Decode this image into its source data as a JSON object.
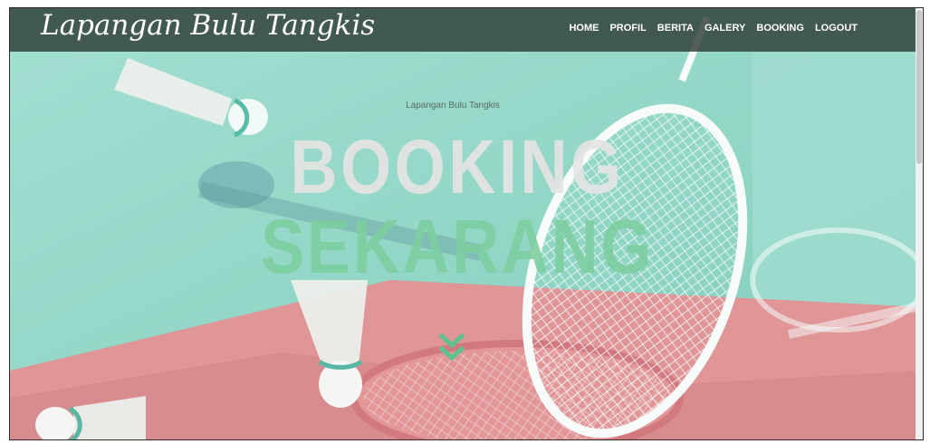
{
  "navbar": {
    "brand": "Lapangan Bulu Tangkis",
    "links": [
      {
        "label": "HOME"
      },
      {
        "label": "PROFIL"
      },
      {
        "label": "BERITA"
      },
      {
        "label": "GALERY"
      },
      {
        "label": "BOOKING"
      },
      {
        "label": "LOGOUT"
      }
    ]
  },
  "hero": {
    "subtitle": "Lapangan Bulu Tangkis",
    "headline_line1": "BOOKING",
    "headline_line2": "SEKARANG"
  },
  "colors": {
    "navbar_bg": "#2d3c37",
    "hero_teal": "#8ed7c6",
    "hero_pink": "#e88b8e",
    "accent_green": "#7dcda0"
  },
  "icons": {
    "scroll_down": "double-chevron-down-icon"
  }
}
